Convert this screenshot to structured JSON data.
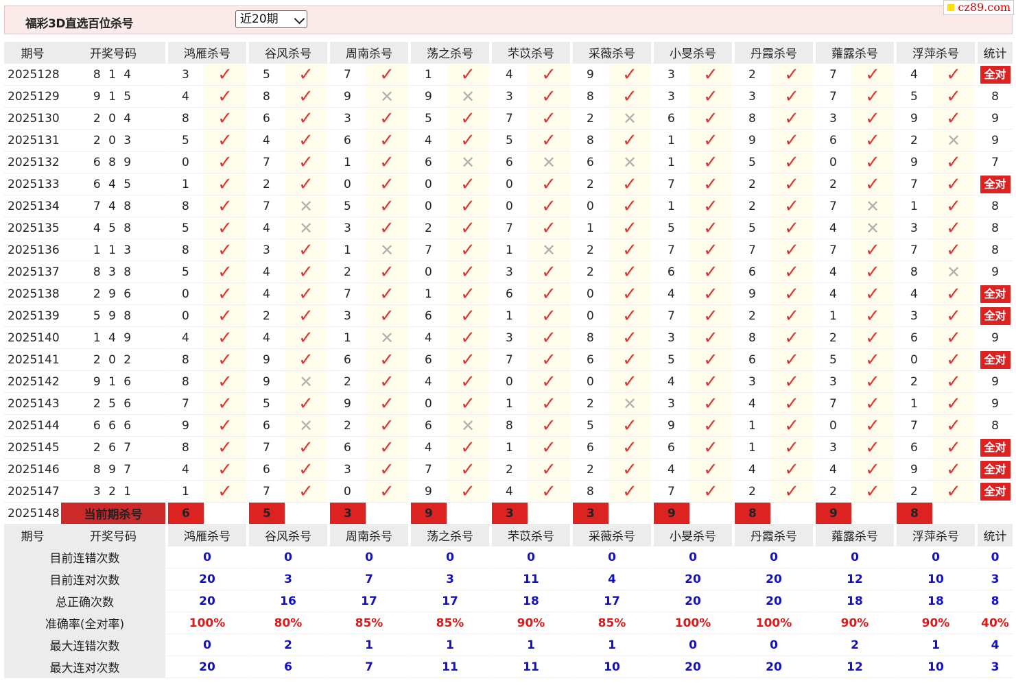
{
  "page": {
    "title": "福彩3D直选百位杀号",
    "period_select": "近20期",
    "logo": "cz89.com"
  },
  "headers": [
    "期号",
    "开奖号码",
    "鸿雁杀号",
    "谷风杀号",
    "周南杀号",
    "荡之杀号",
    "芣苡杀号",
    "采薇杀号",
    "小旻杀号",
    "丹霞杀号",
    "蕹露杀号",
    "浮萍杀号",
    "统计"
  ],
  "colors": {
    "accent": "#d22222",
    "check": "#e53333",
    "cross": "#b0b0b0",
    "blue_value": "#1010c8",
    "header_bg": "#ececec",
    "mark_bg": "#fffdec",
    "topbar_bg": "#fbeaea"
  },
  "icons": {
    "hit": "check-icon",
    "miss": "cross-icon"
  },
  "rows": [
    {
      "period": "2025128",
      "draw": "8 1 4",
      "kills": [
        "3",
        "5",
        "7",
        "1",
        "4",
        "9",
        "3",
        "2",
        "7",
        "4"
      ],
      "hits": [
        1,
        1,
        1,
        1,
        1,
        1,
        1,
        1,
        1,
        1
      ],
      "stat": "全对"
    },
    {
      "period": "2025129",
      "draw": "9 1 5",
      "kills": [
        "4",
        "8",
        "9",
        "9",
        "3",
        "8",
        "3",
        "3",
        "7",
        "5"
      ],
      "hits": [
        1,
        1,
        0,
        0,
        1,
        1,
        1,
        1,
        1,
        1
      ],
      "stat": "8"
    },
    {
      "period": "2025130",
      "draw": "2 0 4",
      "kills": [
        "8",
        "6",
        "3",
        "5",
        "7",
        "2",
        "6",
        "8",
        "3",
        "9"
      ],
      "hits": [
        1,
        1,
        1,
        1,
        1,
        0,
        1,
        1,
        1,
        1
      ],
      "stat": "9"
    },
    {
      "period": "2025131",
      "draw": "2 0 3",
      "kills": [
        "5",
        "4",
        "6",
        "4",
        "5",
        "8",
        "1",
        "9",
        "6",
        "2"
      ],
      "hits": [
        1,
        1,
        1,
        1,
        1,
        1,
        1,
        1,
        1,
        0
      ],
      "stat": "9"
    },
    {
      "period": "2025132",
      "draw": "6 8 9",
      "kills": [
        "0",
        "7",
        "1",
        "6",
        "6",
        "6",
        "1",
        "5",
        "0",
        "9"
      ],
      "hits": [
        1,
        1,
        1,
        0,
        0,
        0,
        1,
        1,
        1,
        1
      ],
      "stat": "7"
    },
    {
      "period": "2025133",
      "draw": "6 4 5",
      "kills": [
        "1",
        "2",
        "0",
        "0",
        "0",
        "2",
        "7",
        "2",
        "2",
        "7"
      ],
      "hits": [
        1,
        1,
        1,
        1,
        1,
        1,
        1,
        1,
        1,
        1
      ],
      "stat": "全对"
    },
    {
      "period": "2025134",
      "draw": "7 4 8",
      "kills": [
        "8",
        "7",
        "5",
        "0",
        "0",
        "0",
        "1",
        "2",
        "7",
        "1"
      ],
      "hits": [
        1,
        0,
        1,
        1,
        1,
        1,
        1,
        1,
        0,
        1
      ],
      "stat": "8"
    },
    {
      "period": "2025135",
      "draw": "4 5 8",
      "kills": [
        "5",
        "4",
        "3",
        "2",
        "7",
        "1",
        "5",
        "5",
        "4",
        "3"
      ],
      "hits": [
        1,
        0,
        1,
        1,
        1,
        1,
        1,
        1,
        0,
        1
      ],
      "stat": "8"
    },
    {
      "period": "2025136",
      "draw": "1 1 3",
      "kills": [
        "8",
        "3",
        "1",
        "7",
        "1",
        "2",
        "7",
        "7",
        "7",
        "7"
      ],
      "hits": [
        1,
        1,
        0,
        1,
        0,
        1,
        1,
        1,
        1,
        1
      ],
      "stat": "8"
    },
    {
      "period": "2025137",
      "draw": "8 3 8",
      "kills": [
        "5",
        "4",
        "2",
        "0",
        "3",
        "2",
        "6",
        "6",
        "4",
        "8"
      ],
      "hits": [
        1,
        1,
        1,
        1,
        1,
        1,
        1,
        1,
        1,
        0
      ],
      "stat": "9"
    },
    {
      "period": "2025138",
      "draw": "2 9 6",
      "kills": [
        "0",
        "4",
        "7",
        "1",
        "6",
        "0",
        "4",
        "9",
        "4",
        "4"
      ],
      "hits": [
        1,
        1,
        1,
        1,
        1,
        1,
        1,
        1,
        1,
        1
      ],
      "stat": "全对"
    },
    {
      "period": "2025139",
      "draw": "5 9 8",
      "kills": [
        "0",
        "2",
        "3",
        "6",
        "1",
        "0",
        "7",
        "2",
        "1",
        "3"
      ],
      "hits": [
        1,
        1,
        1,
        1,
        1,
        1,
        1,
        1,
        1,
        1
      ],
      "stat": "全对"
    },
    {
      "period": "2025140",
      "draw": "1 4 9",
      "kills": [
        "4",
        "4",
        "1",
        "4",
        "3",
        "8",
        "3",
        "8",
        "2",
        "6"
      ],
      "hits": [
        1,
        1,
        0,
        1,
        1,
        1,
        1,
        1,
        1,
        1
      ],
      "stat": "9"
    },
    {
      "period": "2025141",
      "draw": "2 0 2",
      "kills": [
        "8",
        "9",
        "6",
        "6",
        "7",
        "6",
        "5",
        "6",
        "5",
        "0"
      ],
      "hits": [
        1,
        1,
        1,
        1,
        1,
        1,
        1,
        1,
        1,
        1
      ],
      "stat": "全对"
    },
    {
      "period": "2025142",
      "draw": "9 1 6",
      "kills": [
        "8",
        "9",
        "2",
        "4",
        "0",
        "0",
        "4",
        "3",
        "3",
        "2"
      ],
      "hits": [
        1,
        0,
        1,
        1,
        1,
        1,
        1,
        1,
        1,
        1
      ],
      "stat": "9"
    },
    {
      "period": "2025143",
      "draw": "2 5 6",
      "kills": [
        "7",
        "5",
        "9",
        "0",
        "1",
        "2",
        "3",
        "4",
        "7",
        "1"
      ],
      "hits": [
        1,
        1,
        1,
        1,
        1,
        0,
        1,
        1,
        1,
        1
      ],
      "stat": "9"
    },
    {
      "period": "2025144",
      "draw": "6 6 6",
      "kills": [
        "9",
        "6",
        "2",
        "6",
        "8",
        "5",
        "9",
        "1",
        "0",
        "7"
      ],
      "hits": [
        1,
        0,
        1,
        0,
        1,
        1,
        1,
        1,
        1,
        1
      ],
      "stat": "8"
    },
    {
      "period": "2025145",
      "draw": "2 6 7",
      "kills": [
        "8",
        "7",
        "6",
        "4",
        "1",
        "6",
        "6",
        "1",
        "3",
        "6"
      ],
      "hits": [
        1,
        1,
        1,
        1,
        1,
        1,
        1,
        1,
        1,
        1
      ],
      "stat": "全对"
    },
    {
      "period": "2025146",
      "draw": "8 9 7",
      "kills": [
        "4",
        "6",
        "3",
        "7",
        "2",
        "2",
        "4",
        "4",
        "4",
        "9"
      ],
      "hits": [
        1,
        1,
        1,
        1,
        1,
        1,
        1,
        1,
        1,
        1
      ],
      "stat": "全对"
    },
    {
      "period": "2025147",
      "draw": "3 2 1",
      "kills": [
        "1",
        "7",
        "0",
        "9",
        "4",
        "8",
        "7",
        "2",
        "2",
        "2"
      ],
      "hits": [
        1,
        1,
        1,
        1,
        1,
        1,
        1,
        1,
        1,
        1
      ],
      "stat": "全对"
    }
  ],
  "current": {
    "period": "2025148",
    "label": "当前期杀号",
    "kills": [
      "6",
      "5",
      "3",
      "9",
      "3",
      "3",
      "9",
      "8",
      "9",
      "8"
    ]
  },
  "summary": [
    {
      "label": "目前连错次数",
      "values": [
        "0",
        "0",
        "0",
        "0",
        "0",
        "0",
        "0",
        "0",
        "0",
        "0"
      ],
      "stat": "0",
      "color": "blue"
    },
    {
      "label": "目前连对次数",
      "values": [
        "20",
        "3",
        "7",
        "3",
        "11",
        "4",
        "20",
        "20",
        "12",
        "10"
      ],
      "stat": "3",
      "color": "blue"
    },
    {
      "label": "总正确次数",
      "values": [
        "20",
        "16",
        "17",
        "17",
        "18",
        "17",
        "20",
        "20",
        "18",
        "18"
      ],
      "stat": "8",
      "color": "blue"
    },
    {
      "label": "准确率(全对率)",
      "values": [
        "100%",
        "80%",
        "85%",
        "85%",
        "90%",
        "85%",
        "100%",
        "100%",
        "90%",
        "90%"
      ],
      "stat": "40%",
      "color": "red"
    },
    {
      "label": "最大连错次数",
      "values": [
        "0",
        "2",
        "1",
        "1",
        "1",
        "1",
        "0",
        "0",
        "2",
        "1"
      ],
      "stat": "4",
      "color": "blue"
    },
    {
      "label": "最大连对次数",
      "values": [
        "20",
        "6",
        "7",
        "11",
        "11",
        "10",
        "20",
        "20",
        "12",
        "10"
      ],
      "stat": "3",
      "color": "blue"
    }
  ]
}
